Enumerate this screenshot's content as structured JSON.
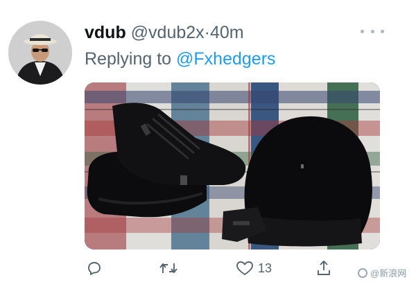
{
  "tweet": {
    "author_name": "vdub",
    "author_handle": "@vdub2x",
    "separator": "·",
    "timestamp": "40m",
    "replying_prefix": "Replying to",
    "replying_to": "@Fxhedgers",
    "avatar_icon": "profile-photo",
    "more_icon": "more-dots-icon",
    "media_description_icon": "photo"
  },
  "actions": {
    "reply_icon": "reply-icon",
    "retweet_icon": "retweet-icon",
    "like_icon": "heart-icon",
    "like_count": "13",
    "share_icon": "share-icon"
  },
  "watermark": {
    "text": "@新浪网"
  },
  "colors": {
    "name": "#0f1419",
    "secondary": "#536471",
    "link": "#1d9bf0",
    "icon": "#536471"
  }
}
